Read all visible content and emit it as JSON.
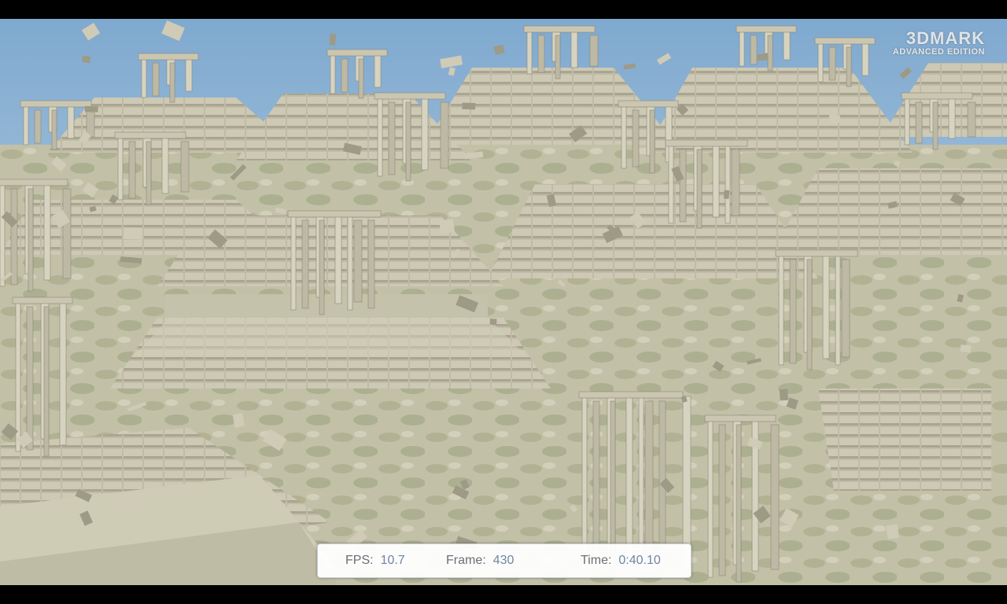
{
  "logo": {
    "title": "3DMARK",
    "edition": "ADVANCED EDITION"
  },
  "hud": {
    "fps_label": "FPS:",
    "fps_value": "10.7",
    "frame_label": "Frame:",
    "frame_value": "430",
    "time_label": "Time:",
    "time_value": "0:40.10"
  },
  "colors": {
    "sky_top": "#7fa9cf",
    "sky_bottom": "#d3e2ea",
    "stone": "#c9c6b3",
    "stone_shadow": "#8a8876",
    "ground": "#b4b49a",
    "hud_value": "#6f86a6"
  },
  "icons": {
    "logo": "3dmark-logo"
  }
}
